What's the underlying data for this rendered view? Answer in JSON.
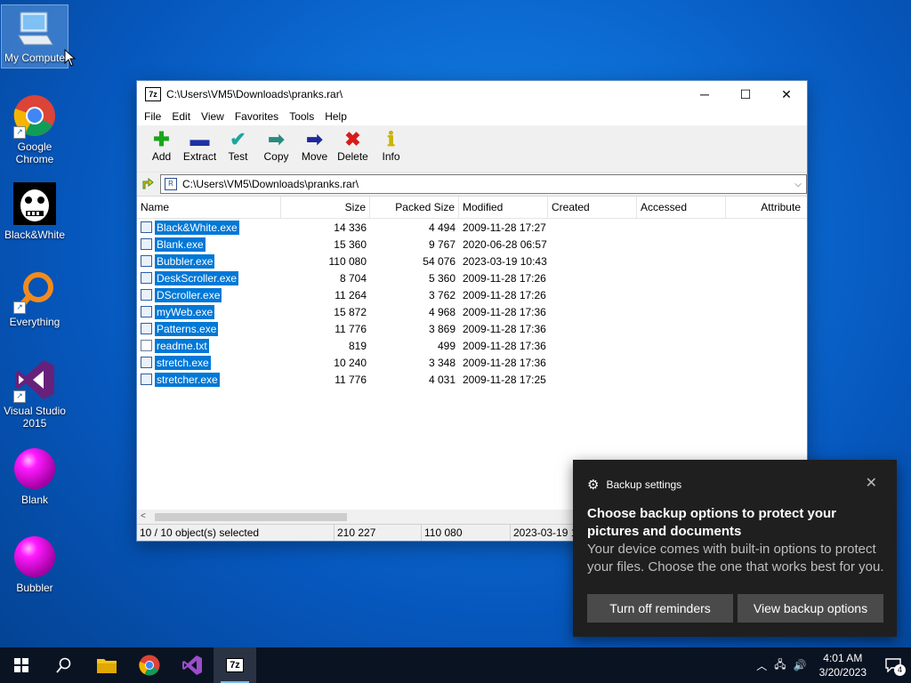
{
  "desktop": {
    "icons": [
      {
        "label": "My Compute"
      },
      {
        "label": "Google Chrome"
      },
      {
        "label": "Black&White"
      },
      {
        "label": "Everything"
      },
      {
        "label": "Visual Studio 2015"
      },
      {
        "label": "Blank"
      },
      {
        "label": "Bubbler"
      }
    ]
  },
  "window": {
    "title": "C:\\Users\\VM5\\Downloads\\pranks.rar\\",
    "app_icon_text": "7z",
    "controls": {
      "minimize": "─",
      "maximize": "☐",
      "close": "✕"
    },
    "menu": [
      "File",
      "Edit",
      "View",
      "Favorites",
      "Tools",
      "Help"
    ],
    "toolbar": [
      {
        "label": "Add",
        "glyph": "✚",
        "color": "#1aa51a"
      },
      {
        "label": "Extract",
        "glyph": "▬",
        "color": "#1f2fa8"
      },
      {
        "label": "Test",
        "glyph": "✔",
        "color": "#19a7a0"
      },
      {
        "label": "Copy",
        "glyph": "➡",
        "color": "#2a8a7e"
      },
      {
        "label": "Move",
        "glyph": "➡",
        "color": "#1e2a9a"
      },
      {
        "label": "Delete",
        "glyph": "✖",
        "color": "#d81b1b"
      },
      {
        "label": "Info",
        "glyph": "ℹ",
        "color": "#c9b400"
      }
    ],
    "address": "C:\\Users\\VM5\\Downloads\\pranks.rar\\",
    "columns": {
      "name": "Name",
      "size": "Size",
      "packed": "Packed Size",
      "modified": "Modified",
      "created": "Created",
      "accessed": "Accessed",
      "attributes": "Attribute"
    },
    "files": [
      {
        "name": "Black&White.exe",
        "size": "14 336",
        "packed": "4 494",
        "modified": "2009-11-28 17:27"
      },
      {
        "name": "Blank.exe",
        "size": "15 360",
        "packed": "9 767",
        "modified": "2020-06-28 06:57"
      },
      {
        "name": "Bubbler.exe",
        "size": "110 080",
        "packed": "54 076",
        "modified": "2023-03-19 10:43"
      },
      {
        "name": "DeskScroller.exe",
        "size": "8 704",
        "packed": "5 360",
        "modified": "2009-11-28 17:26"
      },
      {
        "name": "DScroller.exe",
        "size": "11 264",
        "packed": "3 762",
        "modified": "2009-11-28 17:26"
      },
      {
        "name": "myWeb.exe",
        "size": "15 872",
        "packed": "4 968",
        "modified": "2009-11-28 17:36"
      },
      {
        "name": "Patterns.exe",
        "size": "11 776",
        "packed": "3 869",
        "modified": "2009-11-28 17:36"
      },
      {
        "name": "readme.txt",
        "size": "819",
        "packed": "499",
        "modified": "2009-11-28 17:36"
      },
      {
        "name": "stretch.exe",
        "size": "10 240",
        "packed": "3 348",
        "modified": "2009-11-28 17:36"
      },
      {
        "name": "stretcher.exe",
        "size": "11 776",
        "packed": "4 031",
        "modified": "2009-11-28 17:25"
      }
    ],
    "status": {
      "selected": "10 / 10 object(s) selected",
      "size": "210 227",
      "packed": "110 080",
      "modified": "2023-03-19 1"
    }
  },
  "toast": {
    "app": "Backup settings",
    "close": "✕",
    "title": "Choose backup options to protect your pictures and documents",
    "body": "Your device comes with built-in options to protect your files. Choose the one that works best for you.",
    "btn_dismiss": "Turn off reminders",
    "btn_view": "View backup options"
  },
  "taskbar": {
    "time": "4:01 AM",
    "date": "3/20/2023",
    "notification_count": "4",
    "active_app": "7z"
  }
}
